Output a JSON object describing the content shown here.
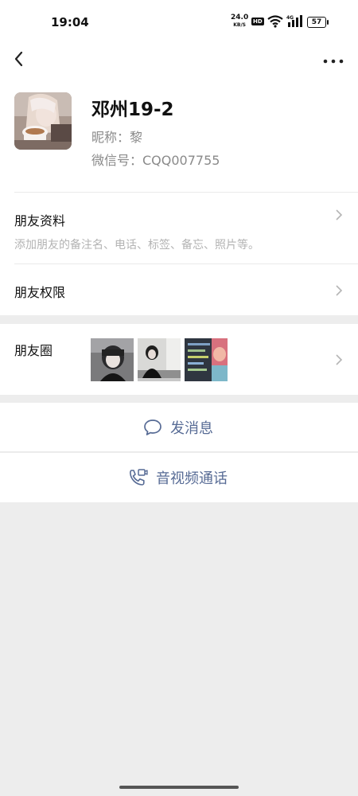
{
  "status_bar": {
    "time": "19:04",
    "net_speed_value": "24.0",
    "net_speed_unit": "KB/S",
    "hd_badge": "HD",
    "signal_label": "4G",
    "battery": "57"
  },
  "navbar": {
    "back_icon": "chevron-left-icon",
    "more_icon": "more-icon"
  },
  "profile": {
    "name": "邓州19-2",
    "nickname": "昵称：黎",
    "wechat_id": "微信号：CQQ007755"
  },
  "rows": {
    "friend_info_title": "朋友资料",
    "friend_info_sub": "添加朋友的备注名、电话、标签、备忘、照片等。",
    "friend_permissions_title": "朋友权限",
    "moments_title": "朋友圈"
  },
  "actions": {
    "send_message": "发消息",
    "video_call": "音视频通话"
  },
  "colors": {
    "link_blue": "#576b95",
    "background_gray": "#ededed",
    "secondary_text": "#8a8a8a"
  }
}
